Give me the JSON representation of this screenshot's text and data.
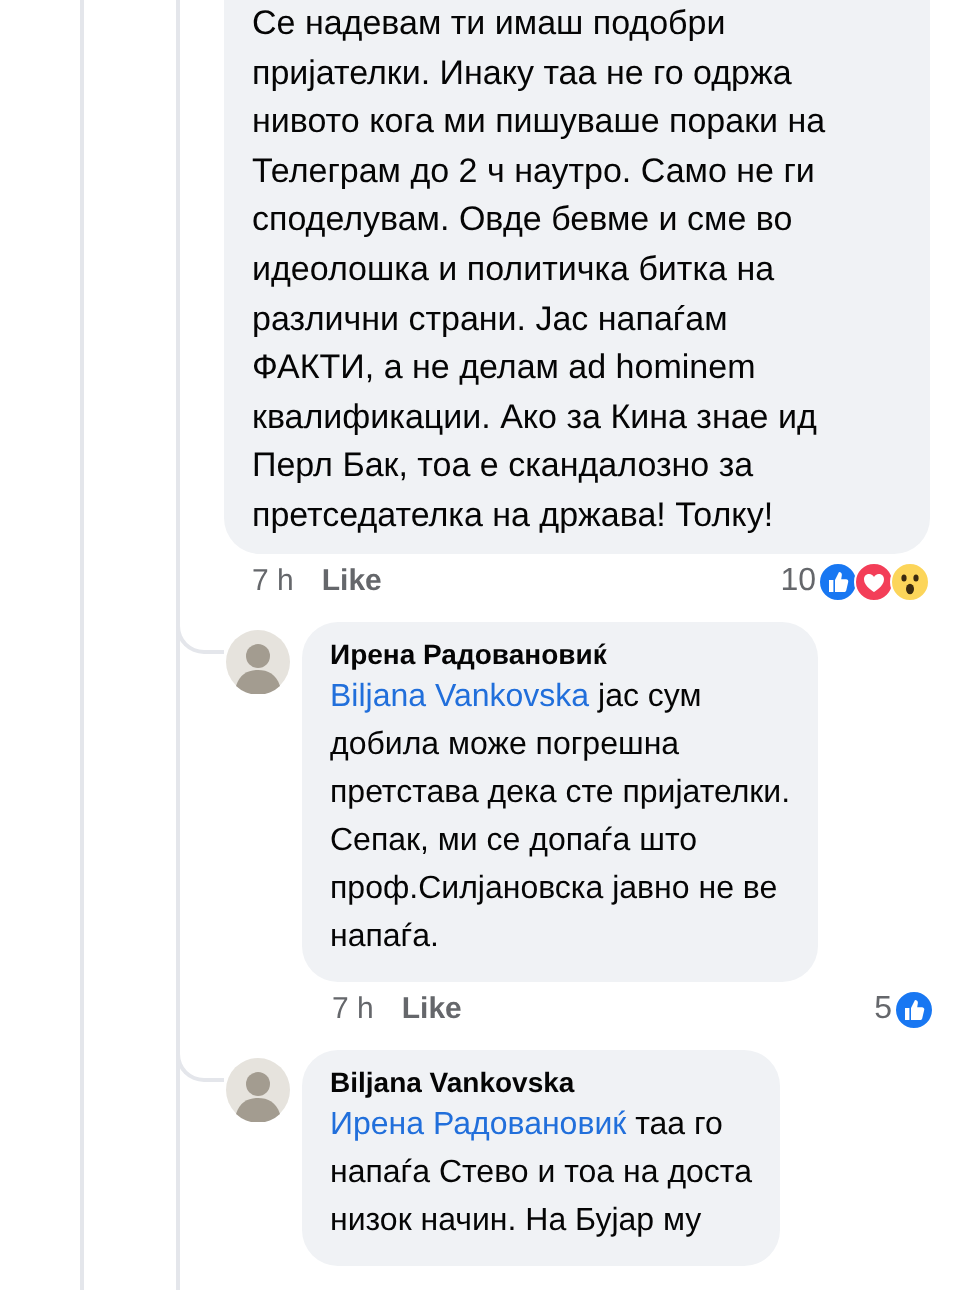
{
  "comments": [
    {
      "kind": "tail",
      "text": "Се надевам ти имаш подобри\nпријателки. Инаку таа не го одржа\nнивото кога ми пишуваше пораки на\nТелеграм до 2 ч наутро. Само не ги\nсподелувам. Овде бевме и сме во\nидеолошка и политичка битка на\nразлични страни. Јас напаѓам\nФАКТИ, а не делам ad hominem\nквалификации. Ако за Кина знае ид\nПерл Бак, тоа е скандалозно за\nпретседателка на држава! Толку!",
      "time": "7 h",
      "like": "Like",
      "reaction_count": "10",
      "reactions": [
        {
          "kind": "like"
        },
        {
          "kind": "love"
        },
        {
          "kind": "wow"
        }
      ]
    },
    {
      "kind": "reply",
      "author": "Ирена Радовановиќ",
      "mention": "Biljana Vankovska",
      "text": " јас сум\nдобила може погрешна\nпретстава дека сте пријателки.\nСепак, ми се допаѓа што\nпроф.Силјановска јавно не ве\nнапаѓа.",
      "time": "7 h",
      "like": "Like",
      "reaction_count": "5",
      "reactions": [
        {
          "kind": "like"
        }
      ]
    },
    {
      "kind": "reply",
      "author": "Biljana Vankovska",
      "mention": "Ирена Радовановиќ",
      "text": " таа го\nнапаѓа Стево и тоа на доста\nнизок начин. На Бујар му"
    }
  ]
}
